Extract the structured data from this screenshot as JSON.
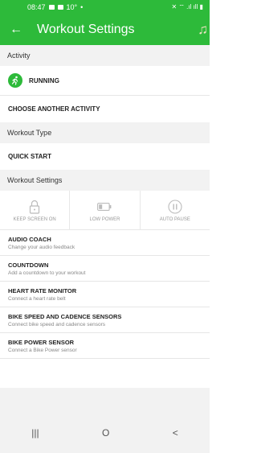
{
  "status_bar": {
    "time": "08:47",
    "temp": "10°",
    "right_text": "✕ ⌔ .ıl ıll ▮"
  },
  "toolbar": {
    "back_icon": "back-arrow-icon",
    "title": "Workout Settings",
    "music_icon": "music-note-icon"
  },
  "activity": {
    "header": "Activity",
    "name": "RUNNING",
    "choose_label": "CHOOSE ANOTHER ACTIVITY"
  },
  "workout_type": {
    "header": "Workout Type",
    "value": "QUICK START"
  },
  "workout_settings": {
    "header": "Workout Settings",
    "toggles": [
      {
        "icon": "lock-icon",
        "label": "KEEP SCREEN ON"
      },
      {
        "icon": "battery-low-icon",
        "label": "LOW POWER"
      },
      {
        "icon": "pause-icon",
        "label": "AUTO PAUSE"
      }
    ]
  },
  "items": [
    {
      "title": "AUDIO COACH",
      "subtitle": "Change your audio feedback"
    },
    {
      "title": "COUNTDOWN",
      "subtitle": "Add a countdown to your workout"
    },
    {
      "title": "HEART RATE MONITOR",
      "subtitle": "Connect a heart rate belt"
    },
    {
      "title": "BIKE SPEED AND CADENCE SENSORS",
      "subtitle": "Connect bike speed and cadence sensors"
    },
    {
      "title": "BIKE POWER SENSOR",
      "subtitle": "Connect a Bike Power sensor"
    }
  ],
  "nav": {
    "recents": "|||",
    "home": "O",
    "back": "<"
  },
  "colors": {
    "brand_green": "#2dba3a",
    "section_bg": "#f2f2f2"
  }
}
